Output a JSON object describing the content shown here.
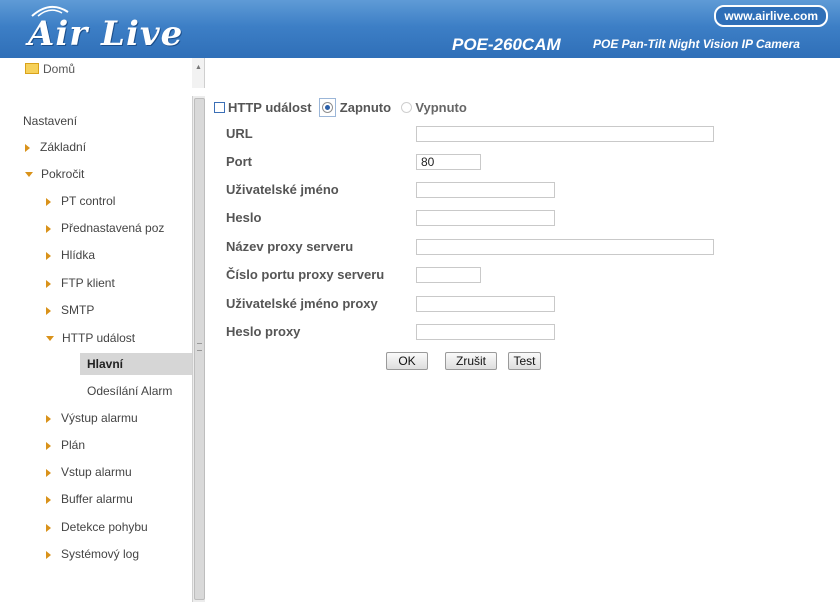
{
  "header": {
    "logo": "Air Live",
    "url": "www.airlive.com",
    "model": "POE-260CAM",
    "tagline": "POE Pan-Tilt Night Vision IP Camera"
  },
  "sidebar": {
    "home": "Domů",
    "heading": "Nastavení",
    "items": [
      {
        "label": "Základní",
        "icon": "triangle-right-icon"
      },
      {
        "label": "Pokročit",
        "icon": "triangle-down-icon"
      },
      {
        "label": "PT control",
        "icon": "triangle-right-icon"
      },
      {
        "label": "Přednastavená poz",
        "icon": "triangle-right-icon"
      },
      {
        "label": "Hlídka",
        "icon": "triangle-right-icon"
      },
      {
        "label": "FTP klient",
        "icon": "triangle-right-icon"
      },
      {
        "label": "SMTP",
        "icon": "triangle-right-icon"
      },
      {
        "label": "HTTP událost",
        "icon": "triangle-down-icon"
      },
      {
        "label": "Hlavní",
        "active": true
      },
      {
        "label": "Odesílání Alarm"
      },
      {
        "label": "Výstup alarmu",
        "icon": "triangle-right-icon"
      },
      {
        "label": "Plán",
        "icon": "triangle-right-icon"
      },
      {
        "label": "Vstup alarmu",
        "icon": "triangle-right-icon"
      },
      {
        "label": "Buffer alarmu",
        "icon": "triangle-right-icon"
      },
      {
        "label": "Detekce pohybu",
        "icon": "triangle-right-icon"
      },
      {
        "label": "Systémový log",
        "icon": "triangle-right-icon"
      }
    ]
  },
  "form": {
    "title": "HTTP událost",
    "on_label": "Zapnuto",
    "off_label": "Vypnuto",
    "selected": "Zapnuto",
    "fields": [
      {
        "label": "URL",
        "value": ""
      },
      {
        "label": "Port",
        "value": "80"
      },
      {
        "label": "Uživatelské jméno",
        "value": ""
      },
      {
        "label": "Heslo",
        "value": ""
      },
      {
        "label": "Název proxy serveru",
        "value": ""
      },
      {
        "label": "Číslo portu proxy serveru",
        "value": ""
      },
      {
        "label": "Uživatelské jméno proxy",
        "value": ""
      },
      {
        "label": "Heslo proxy",
        "value": ""
      }
    ],
    "buttons": {
      "ok": "OK",
      "cancel": "Zrušit",
      "test": "Test"
    }
  },
  "colors": {
    "header": "#3d7fc6",
    "accent": "#d9921a",
    "active_bg": "#d6d6d6"
  }
}
